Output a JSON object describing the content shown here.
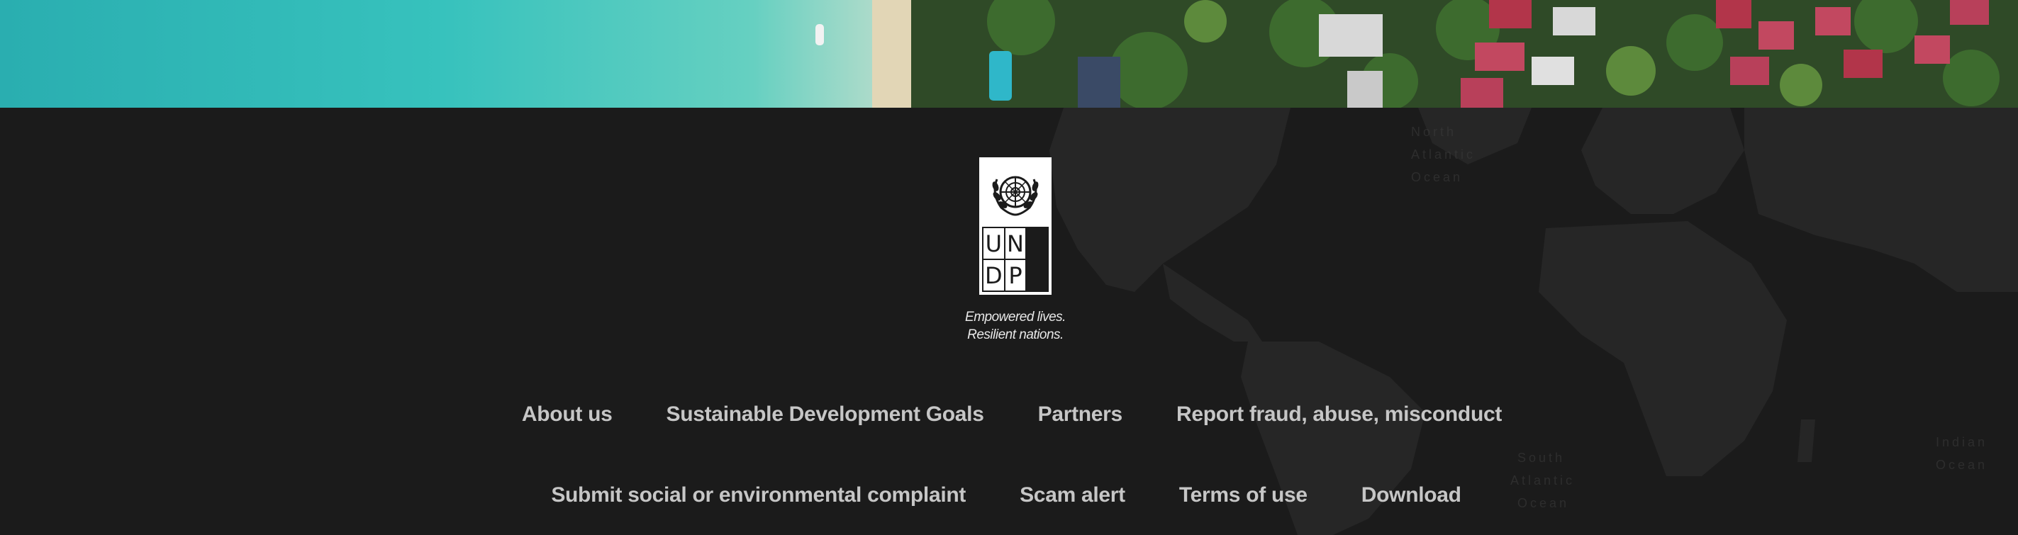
{
  "hero": {
    "image": "aerial-beach-resort-photo"
  },
  "logo": {
    "letters": [
      "U",
      "N",
      "D",
      "P"
    ],
    "emblem": "un-emblem-icon",
    "tagline_line1": "Empowered lives.",
    "tagline_line2": "Resilient nations."
  },
  "footer": {
    "links_row1": [
      {
        "label": "About us"
      },
      {
        "label": "Sustainable Development Goals"
      },
      {
        "label": "Partners"
      },
      {
        "label": "Report fraud, abuse, misconduct"
      }
    ],
    "links_row2": [
      {
        "label": "Submit social or environmental complaint"
      },
      {
        "label": "Scam alert"
      },
      {
        "label": "Terms of use"
      },
      {
        "label": "Download"
      }
    ]
  },
  "colors": {
    "background": "#1b1b1b",
    "link": "#c6c6c6",
    "logo_bg": "#ffffff"
  }
}
